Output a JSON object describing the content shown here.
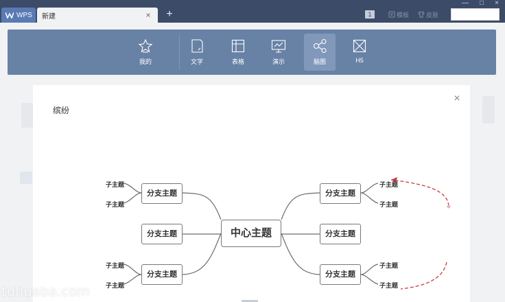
{
  "titlebar": {
    "app_tab_label": "WPS",
    "doc_tab_label": "新建",
    "tab_close_glyph": "×",
    "new_tab_glyph": "+",
    "badge": "1",
    "template_label": "模板",
    "skin_label": "皮肤",
    "window_controls": [
      "—",
      "□",
      "×"
    ],
    "search_value": ""
  },
  "toolbar": {
    "items": [
      {
        "label": "我的",
        "icon": "star-icon"
      },
      {
        "label": "文字",
        "icon": "document-icon"
      },
      {
        "label": "表格",
        "icon": "table-icon"
      },
      {
        "label": "演示",
        "icon": "presentation-icon"
      },
      {
        "label": "脑图",
        "icon": "mindmap-icon",
        "active": true
      },
      {
        "label": "H5",
        "icon": "h5-icon"
      }
    ]
  },
  "dialog": {
    "title": "缤纷",
    "close_glyph": "×",
    "mindmap": {
      "center": "中心主题",
      "branches": [
        "分支主题",
        "分支主题",
        "分支主题",
        "分支主题",
        "分支主题",
        "分支主题"
      ],
      "subtopics": [
        "子主题",
        "子主题",
        "子主题",
        "子主题",
        "子主题",
        "子主题",
        "子主题",
        "子主题"
      ]
    }
  },
  "colors": {
    "titlebar": "#3c4b68",
    "toolbar": "#6882a6",
    "active_tool": "#8198bb",
    "arrow": "#c8383f"
  },
  "watermark": "tuhuaba.com"
}
